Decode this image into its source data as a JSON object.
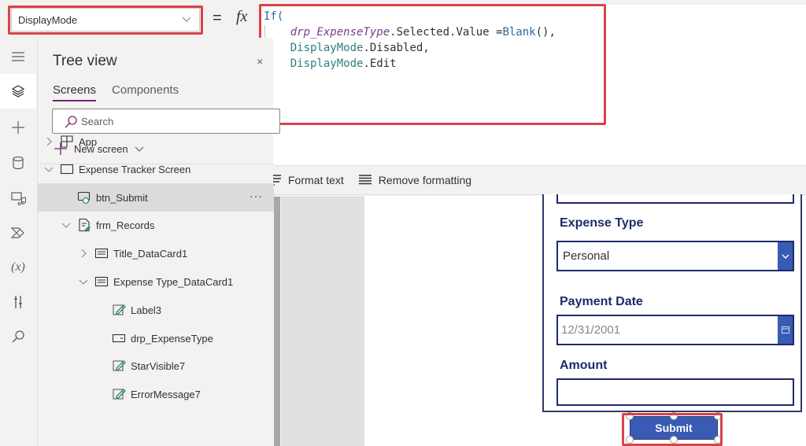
{
  "formula_bar": {
    "property": "DisplayMode",
    "equals": "=",
    "fx": "fx",
    "code_lines": [
      {
        "parts": [
          {
            "t": "If(",
            "c": "kw"
          }
        ]
      },
      {
        "parts": [
          {
            "t": "    ",
            "c": "plain"
          },
          {
            "t": "drp_ExpenseType",
            "c": "ctl"
          },
          {
            "t": ".Selected.Value =",
            "c": "plain"
          },
          {
            "t": "Blank",
            "c": "fn"
          },
          {
            "t": "(),",
            "c": "plain"
          }
        ]
      },
      {
        "parts": [
          {
            "t": "    ",
            "c": "plain"
          },
          {
            "t": "DisplayMode",
            "c": "enum"
          },
          {
            "t": ".Disabled,",
            "c": "plain"
          }
        ]
      },
      {
        "parts": [
          {
            "t": "    ",
            "c": "plain"
          },
          {
            "t": "DisplayMode",
            "c": "enum"
          },
          {
            "t": ".Edit",
            "c": "plain"
          }
        ]
      },
      {
        "parts": [
          {
            "t": ")",
            "c": "plain"
          }
        ]
      }
    ],
    "format_text": "Format text",
    "remove_formatting": "Remove formatting"
  },
  "rail": {
    "items": [
      "menu-icon",
      "layers-icon",
      "insert-icon",
      "data-icon",
      "media-icon",
      "power-automate-icon",
      "variables-icon",
      "advanced-tools-icon",
      "search-icon"
    ]
  },
  "tree_view": {
    "title": "Tree view",
    "close": "×",
    "tabs": [
      {
        "label": "Screens",
        "active": true
      },
      {
        "label": "Components",
        "active": false
      }
    ],
    "search_placeholder": "Search",
    "new_screen": "New screen",
    "nodes": [
      {
        "label": "App",
        "level": 0,
        "twisty": "collapsed",
        "icon": "app-icon"
      },
      {
        "label": "Expense Tracker Screen",
        "level": 0,
        "twisty": "expanded",
        "icon": "screen-icon"
      },
      {
        "label": "btn_Submit",
        "level": 1,
        "twisty": "none",
        "icon": "button-icon",
        "selected": true
      },
      {
        "label": "frm_Records",
        "level": 1,
        "twisty": "expanded",
        "icon": "form-icon"
      },
      {
        "label": "Title_DataCard1",
        "level": 2,
        "twisty": "collapsed",
        "icon": "datacard-icon"
      },
      {
        "label": "Expense Type_DataCard1",
        "level": 2,
        "twisty": "expanded",
        "icon": "datacard-icon"
      },
      {
        "label": "Label3",
        "level": 3,
        "twisty": "none",
        "icon": "label-icon"
      },
      {
        "label": "drp_ExpenseType",
        "level": 3,
        "twisty": "none",
        "icon": "dropdown-icon"
      },
      {
        "label": "StarVisible7",
        "level": 3,
        "twisty": "none",
        "icon": "label-icon"
      },
      {
        "label": "ErrorMessage7",
        "level": 3,
        "twisty": "none",
        "icon": "label-icon"
      }
    ],
    "more": "···"
  },
  "canvas": {
    "expense_type_label": "Expense Type",
    "expense_type_value": "Personal",
    "payment_date_label": "Payment Date",
    "payment_date_value": "12/31/2001",
    "amount_label": "Amount",
    "amount_value": "",
    "submit_label": "Submit"
  },
  "colors": {
    "highlight": "#d9434b",
    "accent_purple": "#742774",
    "form_navy": "#1f2a6b",
    "button_blue": "#3a5bb4"
  }
}
